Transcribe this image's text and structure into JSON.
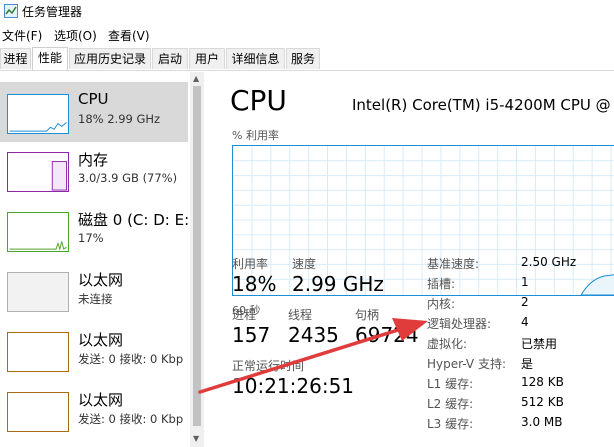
{
  "window": {
    "title": "任务管理器"
  },
  "menu": [
    "文件(F)",
    "选项(O)",
    "查看(V)"
  ],
  "tabs": [
    "进程",
    "性能",
    "应用历史记录",
    "启动",
    "用户",
    "详细信息",
    "服务"
  ],
  "active_tab": "性能",
  "sidebar": [
    {
      "name": "CPU",
      "sub": "18% 2.99 GHz",
      "color": "#1a8fd8"
    },
    {
      "name": "内存",
      "sub": "3.0/3.9 GB (77%)",
      "color": "#8b28a6"
    },
    {
      "name": "磁盘 0 (C: D: E:",
      "sub": "17%",
      "color": "#4ca22c"
    },
    {
      "name": "以太网",
      "sub": "未连接",
      "color": "#a0a0a0"
    },
    {
      "name": "以太网",
      "sub": "发送: 0 接收: 0 Kbp",
      "color": "#a86a16"
    },
    {
      "name": "以太网",
      "sub": "发送: 0 接收: 0 Kbp",
      "color": "#a86a16"
    }
  ],
  "main": {
    "title": "CPU",
    "model": "Intel(R) Core(TM) i5-4200M CPU @",
    "util_label": "% 利用率",
    "time_label": "60 秒",
    "stats": {
      "util_label": "利用率",
      "util_value": "18%",
      "speed_label": "速度",
      "speed_value": "2.99 GHz",
      "proc_label": "进程",
      "proc_value": "157",
      "thread_label": "线程",
      "thread_value": "2435",
      "handle_label": "句柄",
      "handle_value": "69724",
      "uptime_label": "正常运行时间",
      "uptime_value": "10:21:26:51"
    },
    "specs": [
      {
        "k": "基准速度:",
        "v": "2.50 GHz"
      },
      {
        "k": "插槽:",
        "v": "1"
      },
      {
        "k": "内核:",
        "v": "2"
      },
      {
        "k": "逻辑处理器:",
        "v": "4"
      },
      {
        "k": "虚拟化:",
        "v": "已禁用"
      },
      {
        "k": "Hyper-V 支持:",
        "v": "是"
      },
      {
        "k": "L1 缓存:",
        "v": "128 KB"
      },
      {
        "k": "L2 缓存:",
        "v": "512 KB"
      },
      {
        "k": "L3 缓存:",
        "v": "3.0 MB"
      }
    ]
  },
  "annotation_color": "#e03c3c"
}
